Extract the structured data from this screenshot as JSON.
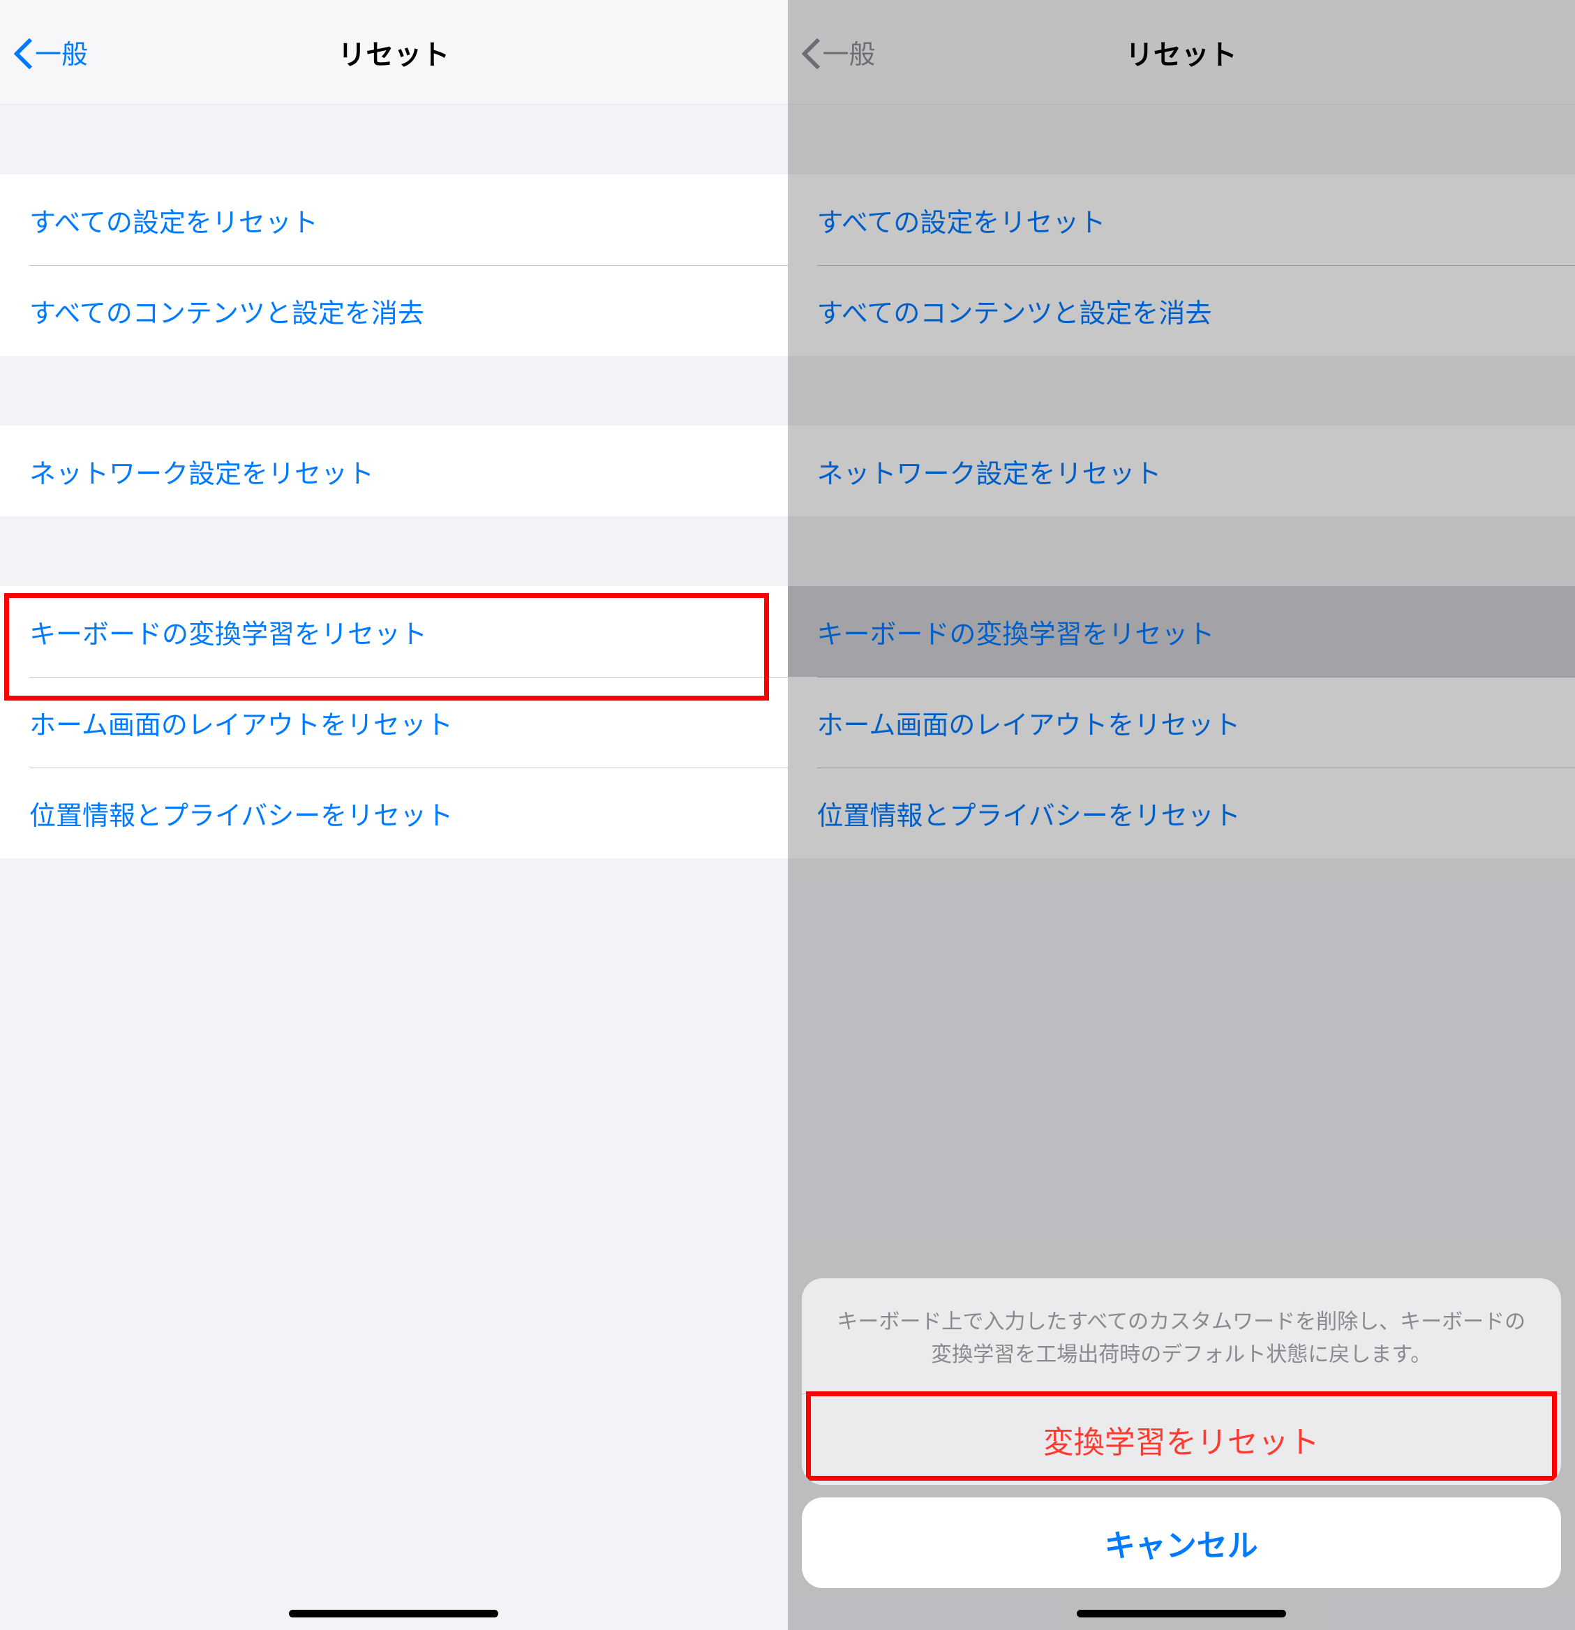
{
  "left": {
    "navbar": {
      "back_label": "一般",
      "title": "リセット"
    },
    "groups": [
      {
        "rows": [
          {
            "label": "すべての設定をリセット",
            "name": "reset-all-settings"
          },
          {
            "label": "すべてのコンテンツと設定を消去",
            "name": "erase-all-content"
          }
        ]
      },
      {
        "rows": [
          {
            "label": "ネットワーク設定をリセット",
            "name": "reset-network"
          }
        ]
      },
      {
        "rows": [
          {
            "label": "キーボードの変換学習をリセット",
            "name": "reset-keyboard-dictionary",
            "highlighted": true
          },
          {
            "label": "ホーム画面のレイアウトをリセット",
            "name": "reset-home-layout"
          },
          {
            "label": "位置情報とプライバシーをリセット",
            "name": "reset-location-privacy"
          }
        ]
      }
    ]
  },
  "right": {
    "navbar": {
      "back_label": "一般",
      "title": "リセット"
    },
    "groups": [
      {
        "rows": [
          {
            "label": "すべての設定をリセット",
            "name": "reset-all-settings"
          },
          {
            "label": "すべてのコンテンツと設定を消去",
            "name": "erase-all-content"
          }
        ]
      },
      {
        "rows": [
          {
            "label": "ネットワーク設定をリセット",
            "name": "reset-network"
          }
        ]
      },
      {
        "rows": [
          {
            "label": "キーボードの変換学習をリセット",
            "name": "reset-keyboard-dictionary",
            "selected": true
          },
          {
            "label": "ホーム画面のレイアウトをリセット",
            "name": "reset-home-layout"
          },
          {
            "label": "位置情報とプライバシーをリセット",
            "name": "reset-location-privacy"
          }
        ]
      }
    ],
    "sheet": {
      "message": "キーボード上で入力したすべてのカスタムワードを削除し、キーボードの変換学習を工場出荷時のデフォルト状態に戻します。",
      "action_label": "変換学習をリセット",
      "cancel_label": "キャンセル"
    }
  }
}
